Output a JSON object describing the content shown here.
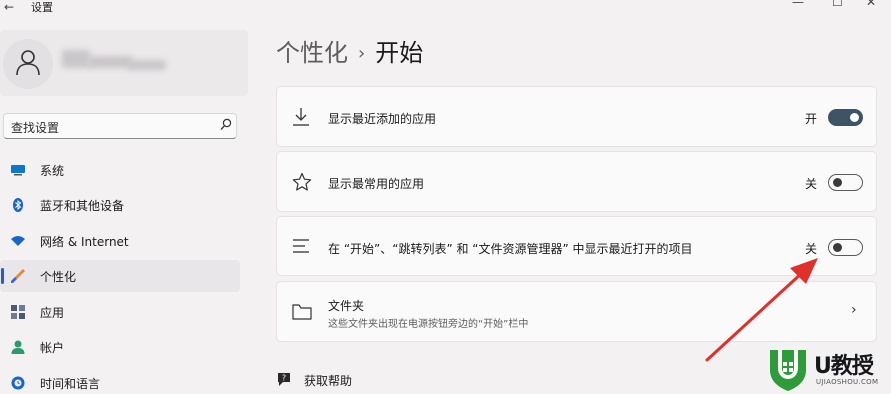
{
  "window": {
    "back_glyph": "←",
    "title": "设置",
    "controls": [
      "—",
      "☐",
      "✕"
    ]
  },
  "sidebar": {
    "search": {
      "placeholder": "查找设置"
    },
    "items": [
      {
        "label": "系统",
        "icon": "monitor-icon",
        "color": "#0a78c8"
      },
      {
        "label": "蓝牙和其他设备",
        "icon": "bluetooth-icon",
        "color": "#1a64c8"
      },
      {
        "label": "网络 & Internet",
        "icon": "wifi-icon",
        "color": "#1a64c8"
      },
      {
        "label": "个性化",
        "icon": "brush-icon",
        "color": "#d07030",
        "active": true
      },
      {
        "label": "应用",
        "icon": "apps-icon",
        "color": "#4a5a70"
      },
      {
        "label": "帐户",
        "icon": "account-icon",
        "color": "#2c9a6a"
      },
      {
        "label": "时间和语言",
        "icon": "globe-clock-icon",
        "color": "#1a64c8"
      }
    ]
  },
  "breadcrumb": {
    "parent": "个性化",
    "separator": "›",
    "current": "开始"
  },
  "settings": [
    {
      "label": "显示最近添加的应用",
      "icon": "download-icon",
      "state_label": "开",
      "on": true
    },
    {
      "label": "显示最常用的应用",
      "icon": "star-icon",
      "state_label": "关",
      "on": false
    },
    {
      "label": "在 “开始”、“跳转列表” 和 “文件资源管理器” 中显示最近打开的项目",
      "icon": "list-icon",
      "state_label": "关",
      "on": false
    },
    {
      "label": "文件夹",
      "sublabel": "这些文件夹出现在电源按钮旁边的“开始”栏中",
      "icon": "folder-icon",
      "chevron": "›"
    }
  ],
  "help": {
    "label": "获取帮助",
    "icon": "help-icon"
  },
  "logo": {
    "text": "U教授",
    "url_text": "UJIAOSHOU.COM"
  },
  "colors": {
    "accent": "#1a64c8",
    "toggle_on": "#3e5364",
    "arrow": "#e0302a",
    "logo_green": "#2e9b3a"
  }
}
